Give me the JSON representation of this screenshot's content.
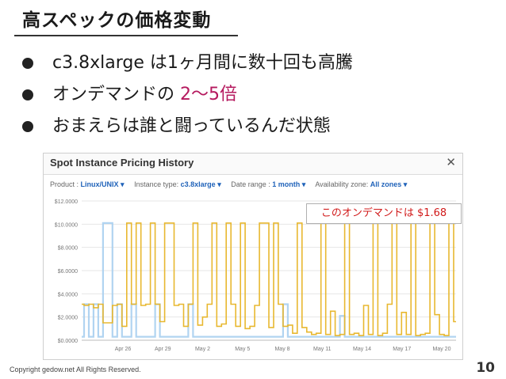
{
  "slide": {
    "title": "高スペックの価格変動",
    "bullets": [
      {
        "before": "c3.8xlarge は1ヶ月間に数十回も高騰",
        "accent": ""
      },
      {
        "before": "オンデマンドの ",
        "accent": "2〜5倍"
      },
      {
        "before": "おまえらは誰と闘っているんだ状態",
        "accent": ""
      }
    ],
    "callout": "このオンデマンドは $1.68",
    "copyright": "Copyright gedow.net All Rights Reserved.",
    "page_number": "10"
  },
  "panel": {
    "title": "Spot Instance Pricing History",
    "close": "✕",
    "filters": {
      "product_label": "Product :",
      "product_value": "Linux/UNIX ▾",
      "instance_label": "Instance type:",
      "instance_value": "c3.8xlarge ▾",
      "date_label": "Date range :",
      "date_value": "1 month ▾",
      "zone_label": "Availability zone:",
      "zone_value": "All zones ▾"
    }
  },
  "chart_data": {
    "type": "line",
    "y_ticks": [
      "$12.0000",
      "$10.0000",
      "$8.0000",
      "$6.0000",
      "$4.0000",
      "$2.0000",
      "$0.0000"
    ],
    "ylim": [
      0,
      12
    ],
    "x_ticks": [
      "Apr 26",
      "Apr 29",
      "May 2",
      "May 5",
      "May 8",
      "May 11",
      "May 14",
      "May 17",
      "May 20"
    ],
    "grid": true,
    "colors": {
      "zone_a": "#a8cff0",
      "zone_b": "#e8b830"
    },
    "series": [
      {
        "values": [
          0.3,
          3.1,
          0.3,
          3.1,
          0.3,
          10.1,
          10.1,
          0.3,
          3.1,
          0.3,
          0.3,
          3.1,
          0.3,
          0.3,
          0.3,
          0.3,
          3.1,
          0.3,
          0.3,
          0.3,
          0.3,
          0.3,
          0.3,
          3.1,
          0.3,
          0.3,
          0.3,
          0.3,
          0.3,
          0.3,
          0.3,
          0.3,
          0.3,
          0.3,
          0.3,
          0.3,
          0.3,
          0.3,
          0.3,
          0.3,
          0.3,
          0.3,
          0.3,
          3.1,
          0.3,
          0.3,
          0.3,
          0.3,
          0.3,
          0.3,
          0.3,
          0.3,
          0.3,
          0.3,
          0.3,
          2.1,
          0.3,
          0.3,
          0.3,
          0.3,
          0.3,
          0.3,
          0.3,
          0.3,
          0.3,
          0.3,
          0.3,
          0.3,
          0.3,
          0.3,
          0.3,
          0.3,
          0.3,
          0.3,
          0.3,
          0.3,
          0.3,
          0.3,
          0.3,
          0.3
        ]
      },
      {
        "values": [
          3.1,
          3.0,
          3.1,
          2.8,
          3.1,
          1.5,
          1.5,
          3.0,
          3.1,
          1.2,
          10.1,
          3.1,
          10.1,
          3.0,
          3.1,
          10.1,
          3.1,
          1.6,
          10.1,
          10.1,
          3.0,
          3.1,
          1.2,
          3.1,
          10.1,
          1.3,
          2.0,
          3.1,
          10.1,
          1.2,
          1.4,
          10.1,
          3.1,
          1.2,
          10.1,
          1.0,
          1.2,
          3.0,
          10.1,
          10.1,
          1.1,
          10.1,
          3.1,
          1.2,
          1.3,
          0.6,
          10.1,
          1.1,
          0.7,
          0.5,
          0.6,
          10.1,
          0.5,
          2.5,
          0.4,
          0.5,
          10.1,
          0.5,
          0.6,
          0.4,
          3.0,
          0.5,
          10.1,
          0.4,
          0.6,
          3.1,
          10.1,
          0.5,
          2.4,
          0.5,
          10.1,
          0.4,
          0.5,
          0.6,
          10.1,
          2.2,
          0.5,
          0.4,
          10.1,
          1.6
        ]
      }
    ]
  }
}
